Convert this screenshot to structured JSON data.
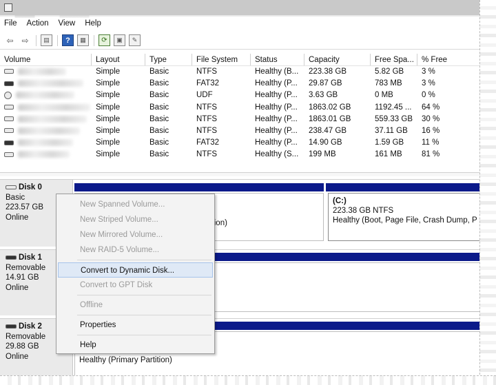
{
  "menubar": [
    "File",
    "Action",
    "View",
    "Help"
  ],
  "toolbar": [
    {
      "icon": "back-arrow-icon",
      "glyph": "⇦"
    },
    {
      "icon": "forward-arrow-icon",
      "glyph": "⇨"
    },
    {
      "icon": "console-tree-icon",
      "glyph": "▤"
    },
    {
      "icon": "help-icon",
      "glyph": "?"
    },
    {
      "icon": "properties-icon",
      "glyph": "▦"
    },
    {
      "icon": "refresh-icon",
      "glyph": "⟳"
    },
    {
      "icon": "connect-icon",
      "glyph": "▣"
    },
    {
      "icon": "wizard-icon",
      "glyph": "✎"
    }
  ],
  "volume_table": {
    "headers": [
      "Volume",
      "Layout",
      "Type",
      "File System",
      "Status",
      "Capacity",
      "Free Spa...",
      "% Free"
    ],
    "rows": [
      {
        "icon": "drive-icon",
        "layout": "Simple",
        "type": "Basic",
        "fs": "NTFS",
        "status": "Healthy (B...",
        "capacity": "223.38 GB",
        "free": "5.82 GB",
        "pct": "3 %"
      },
      {
        "icon": "removable-drive-icon",
        "layout": "Simple",
        "type": "Basic",
        "fs": "FAT32",
        "status": "Healthy (P...",
        "capacity": "29.87 GB",
        "free": "783 MB",
        "pct": "3 %"
      },
      {
        "icon": "cd-drive-icon",
        "layout": "Simple",
        "type": "Basic",
        "fs": "UDF",
        "status": "Healthy (P...",
        "capacity": "3.63 GB",
        "free": "0 MB",
        "pct": "0 %"
      },
      {
        "icon": "drive-icon",
        "layout": "Simple",
        "type": "Basic",
        "fs": "NTFS",
        "status": "Healthy (P...",
        "capacity": "1863.02 GB",
        "free": "1192.45 ...",
        "pct": "64 %"
      },
      {
        "icon": "drive-icon",
        "layout": "Simple",
        "type": "Basic",
        "fs": "NTFS",
        "status": "Healthy (P...",
        "capacity": "1863.01 GB",
        "free": "559.33 GB",
        "pct": "30 %"
      },
      {
        "icon": "drive-icon",
        "layout": "Simple",
        "type": "Basic",
        "fs": "NTFS",
        "status": "Healthy (P...",
        "capacity": "238.47 GB",
        "free": "37.11 GB",
        "pct": "16 %"
      },
      {
        "icon": "removable-drive-icon",
        "layout": "Simple",
        "type": "Basic",
        "fs": "FAT32",
        "status": "Healthy (P...",
        "capacity": "14.90 GB",
        "free": "1.59 GB",
        "pct": "11 %"
      },
      {
        "icon": "drive-icon",
        "layout": "Simple",
        "type": "Basic",
        "fs": "NTFS",
        "status": "Healthy (S...",
        "capacity": "199 MB",
        "free": "161 MB",
        "pct": "81 %"
      }
    ]
  },
  "disks": [
    {
      "name": "Disk 0",
      "type": "Basic",
      "size": "223.57 GB",
      "state": "Online",
      "partition_c": {
        "name": "(C:)",
        "size": "223.38 GB NTFS",
        "status": "Healthy (Boot, Page File, Crash Dump, P"
      },
      "partition_hidden_suffix": "ition)"
    },
    {
      "name": "Disk 1",
      "type": "Removable",
      "size": "14.91 GB",
      "state": "Online"
    },
    {
      "name": "Disk 2",
      "type": "Removable",
      "size": "29.88 GB",
      "state": "Online",
      "partition_status": "Healthy (Primary Partition)"
    }
  ],
  "context_menu": [
    {
      "label": "New Spanned Volume...",
      "disabled": true
    },
    {
      "label": "New Striped Volume...",
      "disabled": true
    },
    {
      "label": "New Mirrored Volume...",
      "disabled": true
    },
    {
      "label": "New RAID-5 Volume...",
      "disabled": true
    },
    {
      "sep": true
    },
    {
      "label": "Convert to Dynamic Disk...",
      "disabled": false,
      "highlight": true
    },
    {
      "label": "Convert to GPT Disk",
      "disabled": true
    },
    {
      "sep": true
    },
    {
      "label": "Offline",
      "disabled": true
    },
    {
      "sep": true
    },
    {
      "label": "Properties",
      "disabled": false
    },
    {
      "sep": true
    },
    {
      "label": "Help",
      "disabled": false
    }
  ],
  "colors": {
    "partition_bar": "#0b1a8a",
    "menu_highlight": "#dfe9f6"
  }
}
